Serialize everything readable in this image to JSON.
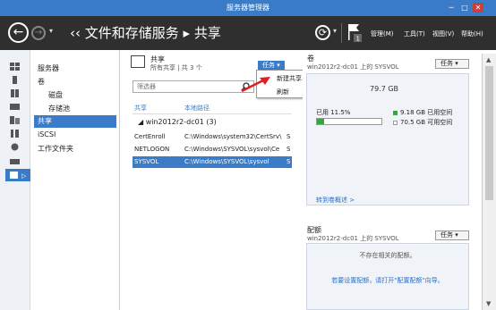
{
  "window": {
    "title": "服务器管理器",
    "minimize": "─",
    "maximize": "□",
    "close": "✕"
  },
  "nav": {
    "back": "←",
    "forward": "→",
    "history": "▾",
    "breadcrumb": "‹‹ 文件和存储服务 ▸ 共享",
    "refresh": "⟳",
    "refresh_dd": "▾",
    "notifications_badge": "1",
    "menu": {
      "manage": "管理(M)",
      "tools": "工具(T)",
      "view": "视图(V)",
      "help": "帮助(H)"
    }
  },
  "sidebar": {
    "items": [
      {
        "label": "服务器"
      },
      {
        "label": "卷"
      },
      {
        "label": "磁盘"
      },
      {
        "label": "存储池"
      },
      {
        "label": "共享"
      },
      {
        "label": "iSCSI"
      },
      {
        "label": "工作文件夹"
      }
    ],
    "icon_expand": "▷"
  },
  "shares": {
    "title": "共享",
    "subtitle": "所有共享 | 共 3 个",
    "tasks_button": "任务  ▾",
    "filter_placeholder": "筛选器",
    "filter_icon": "search-icon",
    "columns": {
      "share": "共享",
      "local_path": "本地路径"
    },
    "group": "◢  win2012r2-dc01 (3)",
    "rows": [
      {
        "share": "CertEnroll",
        "path": "C:\\Windows\\system32\\CertSrv\\",
        "more": "S"
      },
      {
        "share": "NETLOGON",
        "path": "C:\\Windows\\SYSVOL\\sysvol\\Ce",
        "more": "S"
      },
      {
        "share": "SYSVOL",
        "path": "C:\\Windows\\SYSVOL\\sysvol",
        "more": "S"
      }
    ]
  },
  "dropdown": {
    "items": [
      {
        "label": "新建共享..."
      },
      {
        "label": "刷新"
      }
    ]
  },
  "volume": {
    "title": "卷",
    "subtitle": "win2012r2-dc01 上的 SYSVOL",
    "tasks_button": "任务  ▾",
    "capacity": "79.7 GB",
    "used_label": "已用 11.5%",
    "used_fraction": 0.115,
    "legend_used": "9.18 GB 已用空间",
    "legend_free": "70.5 GB 可用空间",
    "link": "转到卷概述 >",
    "colors": {
      "used": "#2eaa3a"
    }
  },
  "quota": {
    "title": "配额",
    "subtitle": "win2012r2-dc01 上的 SYSVOL",
    "tasks_button": "任务  ▾",
    "message": "不存在相关的配额。",
    "link": "若要设置配额，请打开\"配置配额\"向导。"
  },
  "scrollbar": {
    "up": "▲",
    "down": "▼"
  }
}
